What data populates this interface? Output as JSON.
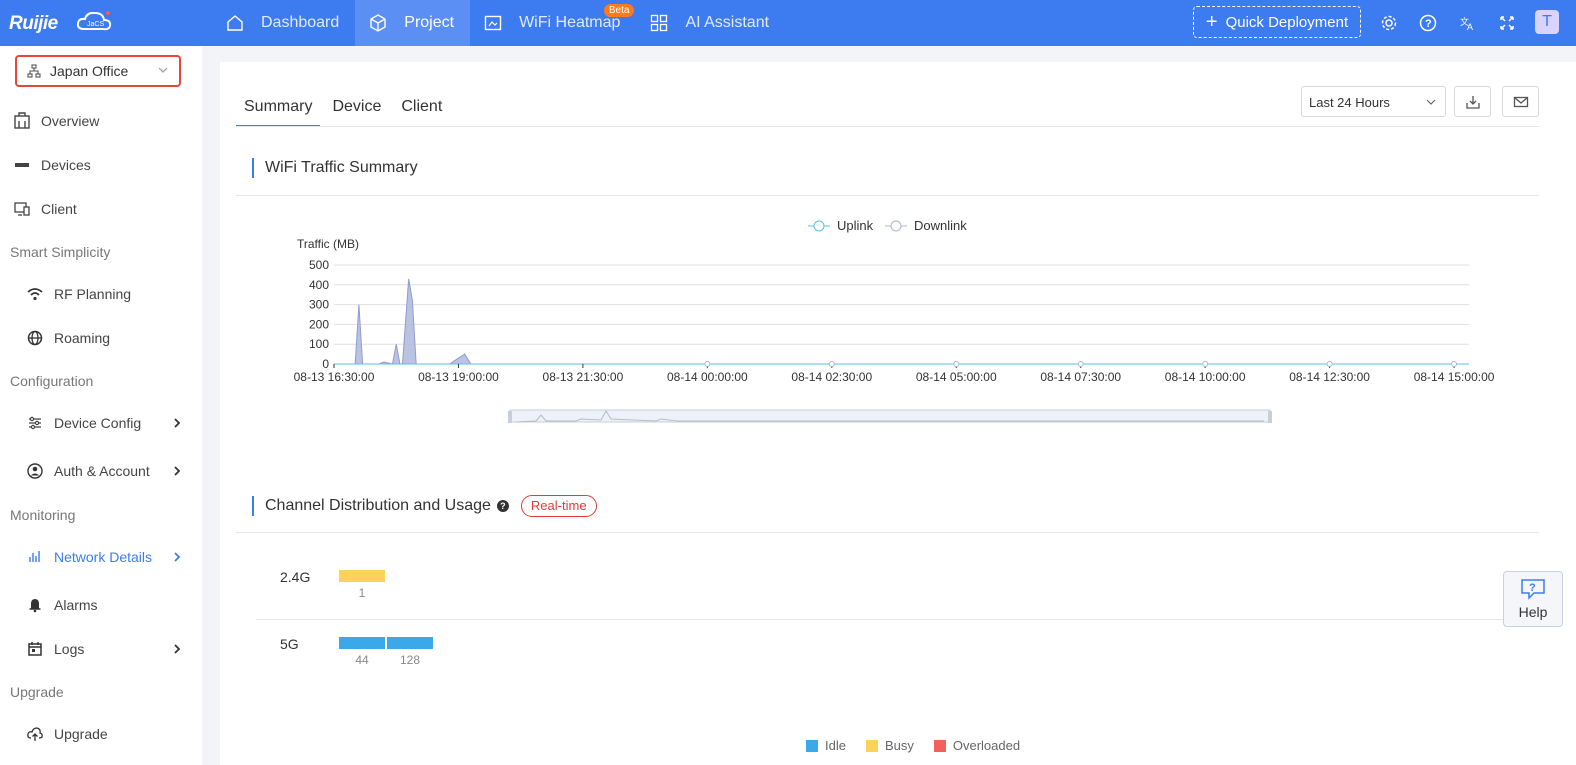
{
  "brand": {
    "logo_text": "Ruijie",
    "logo_badge": "JaCS"
  },
  "nav": {
    "items": [
      {
        "label": "Dashboard",
        "icon": "dashboard-icon"
      },
      {
        "label": "Project",
        "icon": "cube-icon"
      },
      {
        "label": "WiFi Heatmap",
        "icon": "heatmap-icon",
        "badge": "Beta"
      },
      {
        "label": "AI Assistant",
        "icon": "grid-icon"
      }
    ],
    "quick_deployment": "Quick Deployment",
    "avatar_letter": "T"
  },
  "sidebar": {
    "site": "Japan Office",
    "items": [
      {
        "label": "Overview"
      },
      {
        "label": "Devices"
      },
      {
        "label": "Client"
      }
    ],
    "groups": {
      "smart": "Smart Simplicity",
      "config": "Configuration",
      "monitoring": "Monitoring",
      "upgrade": "Upgrade"
    },
    "sub": {
      "rf": "RF Planning",
      "roaming": "Roaming",
      "device_config": "Device Config",
      "auth": "Auth & Account",
      "network": "Network Details",
      "alarms": "Alarms",
      "logs": "Logs",
      "upgrade": "Upgrade"
    }
  },
  "main": {
    "tabs": [
      "Summary",
      "Device",
      "Client"
    ],
    "time_range": "Last 24 Hours",
    "traffic_title": "WiFi Traffic Summary",
    "channel_title": "Channel Distribution and Usage",
    "realtime": "Real-time",
    "help": "Help"
  },
  "chart_data": {
    "type": "area",
    "ylabel": "Traffic (MB)",
    "ylim": [
      0,
      500
    ],
    "yticks": [
      0,
      100,
      200,
      300,
      400,
      500
    ],
    "legend": [
      "Uplink",
      "Downlink"
    ],
    "colors": {
      "uplink": "#5bc0de",
      "downlink": "#aab4d8"
    },
    "xtick_labels": [
      "08-13 16:30:00",
      "08-13 19:00:00",
      "08-13 21:30:00",
      "08-14 00:00:00",
      "08-14 02:30:00",
      "08-14 05:00:00",
      "08-14 07:30:00",
      "08-14 10:00:00",
      "08-14 12:30:00",
      "08-14 15:00:00"
    ],
    "series": [
      {
        "name": "Downlink",
        "points": [
          [
            0,
            0
          ],
          [
            0.17,
            0
          ],
          [
            0.2,
            300
          ],
          [
            0.23,
            0
          ],
          [
            0.36,
            0
          ],
          [
            0.4,
            10
          ],
          [
            0.47,
            0
          ],
          [
            0.5,
            100
          ],
          [
            0.53,
            0
          ],
          [
            0.55,
            0
          ],
          [
            0.6,
            430
          ],
          [
            0.63,
            320
          ],
          [
            0.66,
            0
          ],
          [
            0.93,
            0
          ],
          [
            1.0,
            30
          ],
          [
            1.05,
            50
          ],
          [
            1.1,
            0
          ],
          [
            9.12,
            0
          ]
        ]
      },
      {
        "name": "Uplink",
        "points": [
          [
            0,
            0
          ],
          [
            9.12,
            0
          ]
        ]
      }
    ]
  },
  "channel_data": {
    "bands": [
      {
        "label": "2.4G",
        "bars": [
          {
            "value": 1,
            "status": "busy"
          }
        ]
      },
      {
        "label": "5G",
        "bars": [
          {
            "value": 44,
            "status": "idle"
          },
          {
            "value": 128,
            "status": "idle"
          }
        ]
      }
    ],
    "legend": [
      {
        "label": "Idle",
        "color": "#3aa9ea"
      },
      {
        "label": "Busy",
        "color": "#fdd25b"
      },
      {
        "label": "Overloaded",
        "color": "#f2605b"
      }
    ]
  }
}
